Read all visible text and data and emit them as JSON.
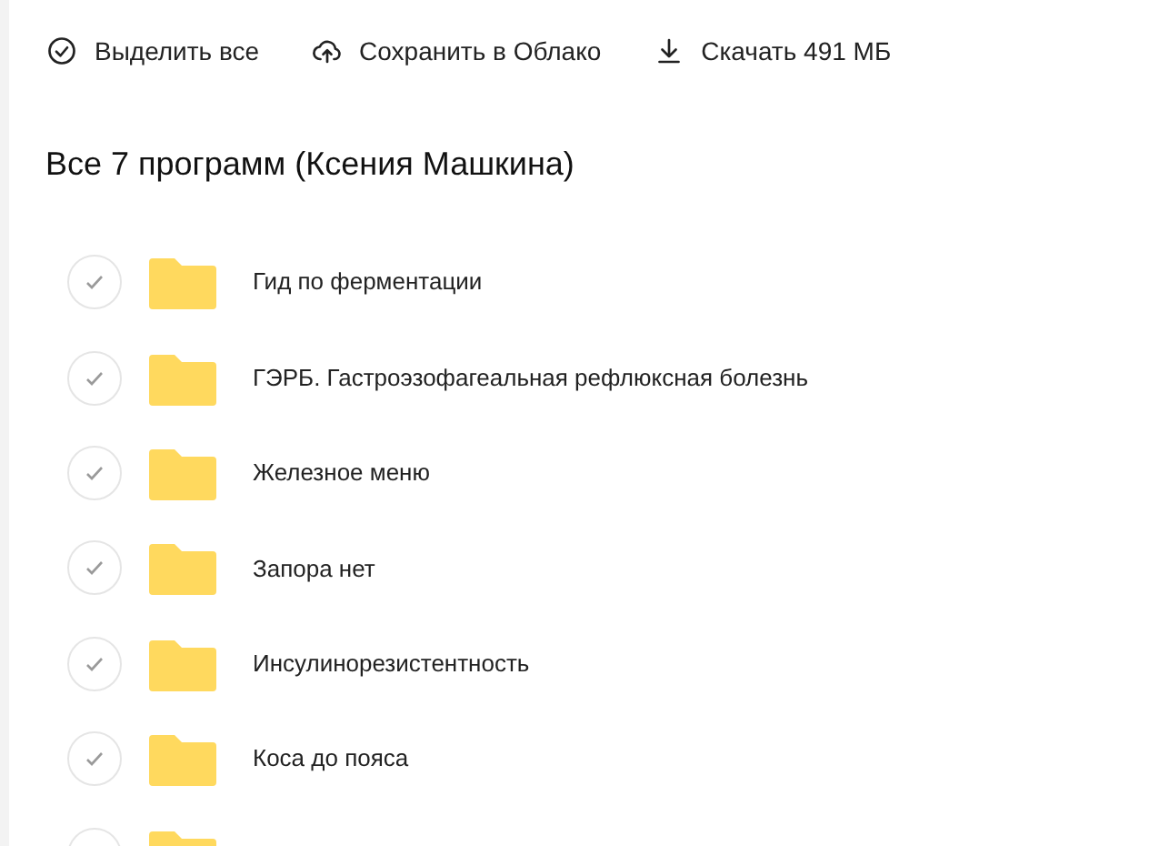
{
  "toolbar": [
    {
      "kind": "select",
      "label": "Выделить все"
    },
    {
      "kind": "cloud",
      "label": "Сохранить в Облако"
    },
    {
      "kind": "download",
      "label": "Скачать 491 МБ"
    }
  ],
  "heading": "Все 7 программ (Ксения Машкина)",
  "items": [
    {
      "name": "Гид по ферментации",
      "selected": false
    },
    {
      "name": "ГЭРБ. Гастроэзофагеальная рефлюксная болезнь",
      "selected": false
    },
    {
      "name": "Железное меню",
      "selected": false
    },
    {
      "name": "Запора нет",
      "selected": false
    },
    {
      "name": "Инсулинорезистентность",
      "selected": false
    },
    {
      "name": "Коса до пояса",
      "selected": false
    },
    {
      "selected": false
    }
  ]
}
